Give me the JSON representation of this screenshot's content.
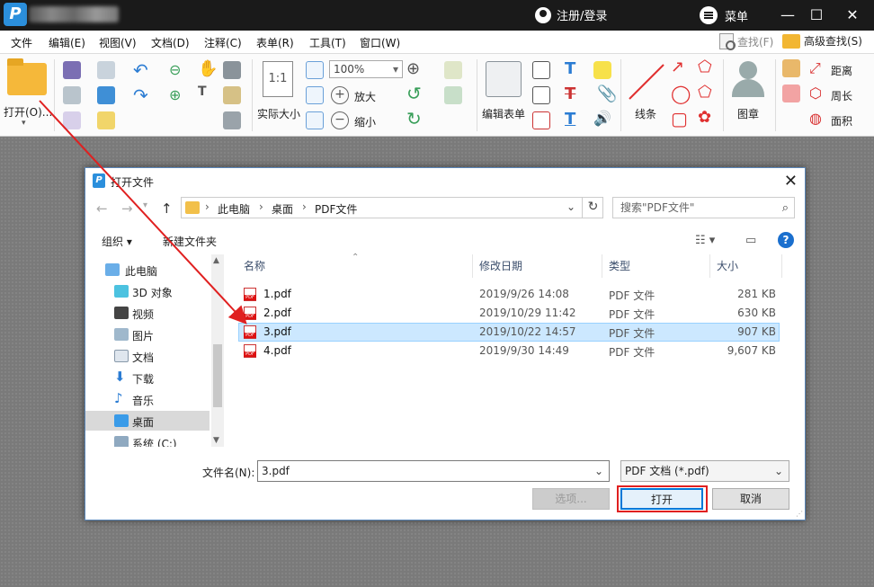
{
  "titlebar": {
    "user_label": "注册/登录",
    "menu_label": "菜单",
    "minimize": "—",
    "maximize": "☐",
    "close": "✕"
  },
  "menubar": {
    "items": [
      "文件",
      "编辑(E)",
      "视图(V)",
      "文档(D)",
      "注释(C)",
      "表单(R)",
      "工具(T)",
      "窗口(W)"
    ],
    "find_label": "查找(F)",
    "advanced_find_label": "高级查找(S)"
  },
  "toolbar": {
    "open_label": "打开(O)...",
    "zoom_value": "100%",
    "actual_size_label": "实际大小",
    "actual_size_icon_text": "1:1",
    "zoom_in_label": "放大",
    "zoom_out_label": "缩小",
    "edit_form_label": "编辑表单",
    "line_label": "线条",
    "stamp_label": "图章",
    "distance_label": "距离",
    "perimeter_label": "周长",
    "area_label": "面积"
  },
  "dialog": {
    "title": "打开文件",
    "breadcrumb": [
      "此电脑",
      "桌面",
      "PDF文件"
    ],
    "search_placeholder": "搜索\"PDF文件\"",
    "organize_label": "组织 ▾",
    "new_folder_label": "新建文件夹",
    "nav_items": [
      {
        "label": "此电脑",
        "icon": "computer-icon"
      },
      {
        "label": "3D 对象",
        "icon": "cube-icon"
      },
      {
        "label": "视频",
        "icon": "video-icon"
      },
      {
        "label": "图片",
        "icon": "picture-icon"
      },
      {
        "label": "文档",
        "icon": "document-icon"
      },
      {
        "label": "下载",
        "icon": "download-icon"
      },
      {
        "label": "音乐",
        "icon": "music-icon"
      },
      {
        "label": "桌面",
        "icon": "desktop-icon"
      },
      {
        "label": "系统 (C:)",
        "icon": "drive-icon"
      }
    ],
    "columns": {
      "name": "名称",
      "date": "修改日期",
      "type": "类型",
      "size": "大小"
    },
    "files": [
      {
        "name": "1.pdf",
        "date": "2019/9/26 14:08",
        "type": "PDF 文件",
        "size": "281 KB"
      },
      {
        "name": "2.pdf",
        "date": "2019/10/29 11:42",
        "type": "PDF 文件",
        "size": "630 KB"
      },
      {
        "name": "3.pdf",
        "date": "2019/10/22 14:57",
        "type": "PDF 文件",
        "size": "907 KB"
      },
      {
        "name": "4.pdf",
        "date": "2019/9/30 14:49",
        "type": "PDF 文件",
        "size": "9,607 KB"
      }
    ],
    "filename_label": "文件名(N):",
    "filename_value": "3.pdf",
    "filetype_value": "PDF 文档 (*.pdf)",
    "options_label": "选项...",
    "open_label": "打开",
    "cancel_label": "取消"
  },
  "colors": {
    "titlebar_bg": "#1a1a1a",
    "selection_bg": "#cce8ff",
    "annotation_red": "#e02020",
    "folder_yellow": "#f5b83a"
  }
}
